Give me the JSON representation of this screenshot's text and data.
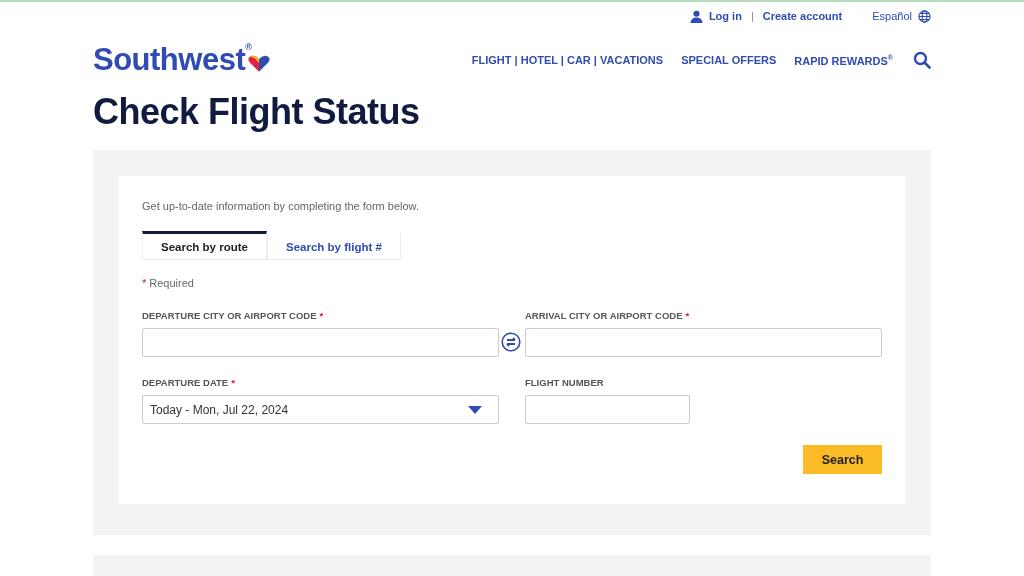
{
  "top_links": {
    "login": "Log in",
    "separator": "|",
    "create": "Create account",
    "language": "Español"
  },
  "logo": "Southwest$^{®}$",
  "nav": [
    "FLIGHT | HOTEL | CAR | VACATIONS",
    "SPECIAL OFFERS",
    "RAPID REWARDS$^{®}$"
  ],
  "title": "Check Flight Status",
  "form": {
    "intro": "Get up-to-date information by completing the form below.",
    "tabs": [
      {
        "label": "Search by route",
        "selected": true
      },
      {
        "label": "Search by flight #",
        "selected": false
      }
    ],
    "required_mark": "*",
    "required_note": "Required",
    "fields": [
      {
        "label": "DEPARTURE CITY OR AIRPORT CODE",
        "required": true,
        "kind": "text"
      },
      {
        "label": "ARRIVAL CITY OR AIRPORT CODE",
        "required": true,
        "kind": "text"
      },
      {
        "label": "DEPARTURE DATE",
        "required": true,
        "kind": "select",
        "value": "Today - Mon, Jul 22, 2024"
      },
      {
        "label": "FLIGHT NUMBER",
        "required": false,
        "kind": "short"
      }
    ],
    "submit": "Search"
  }
}
